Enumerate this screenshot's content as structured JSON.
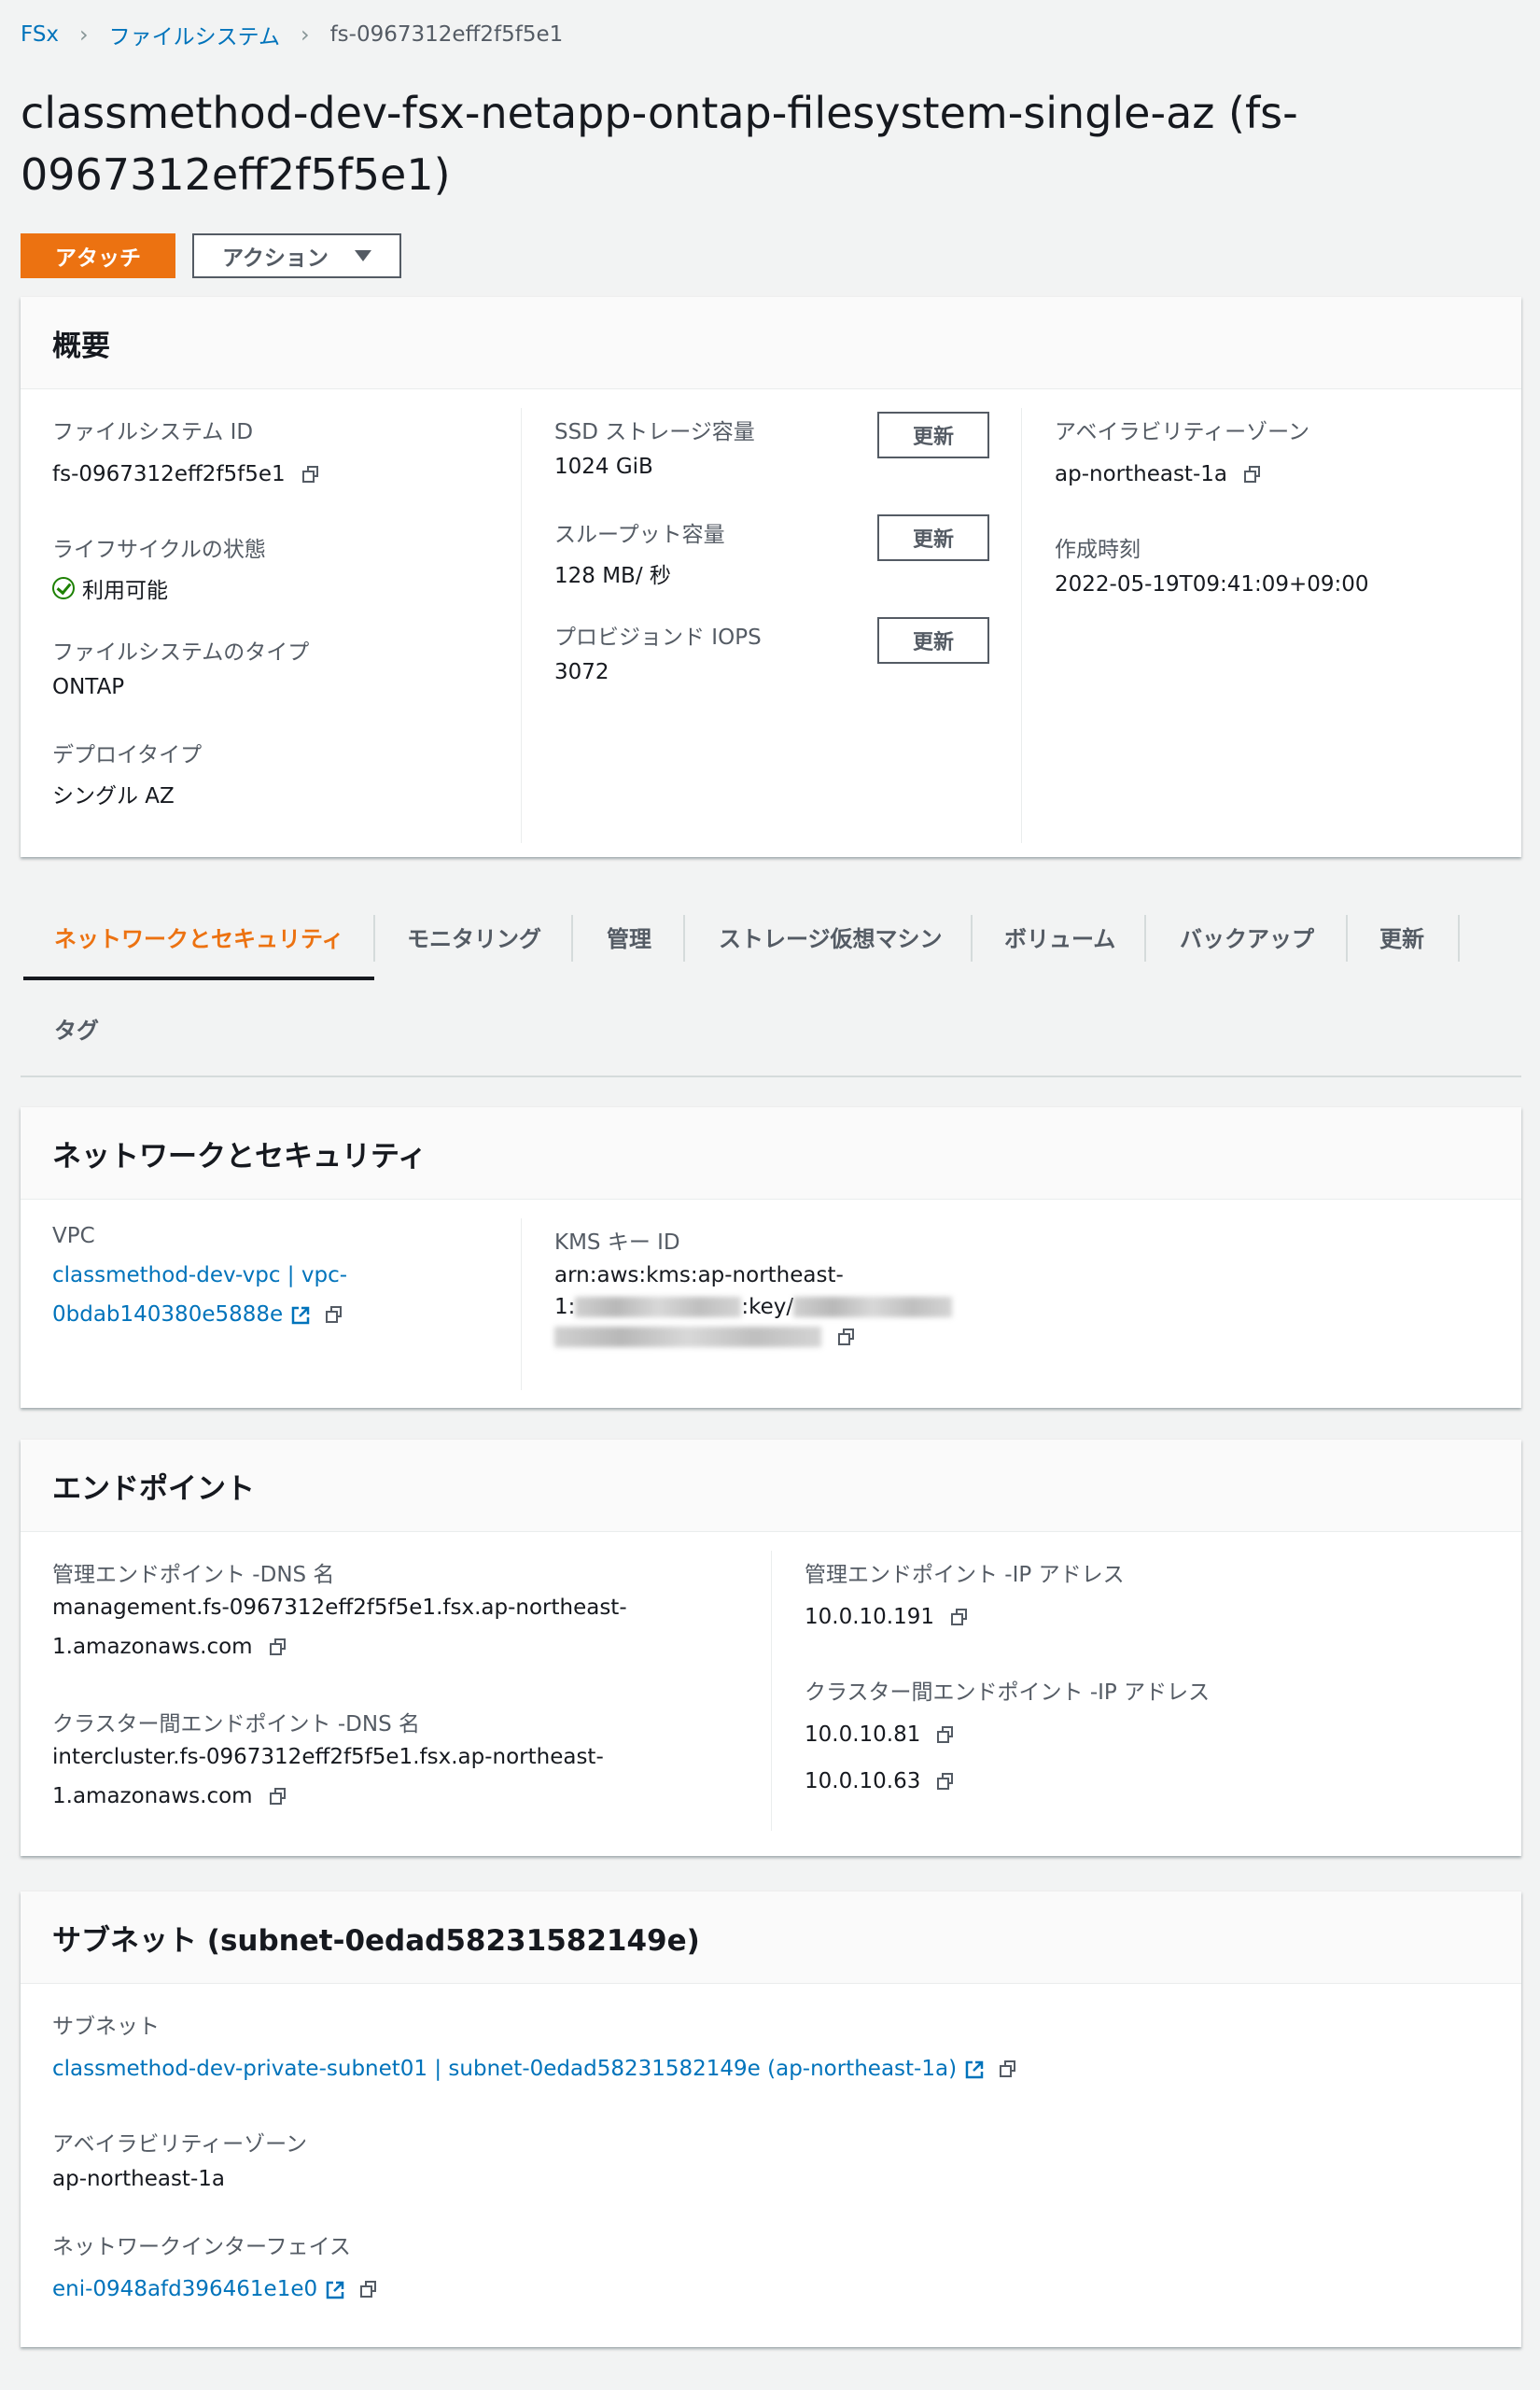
{
  "breadcrumb": {
    "root": "FSx",
    "level2": "ファイルシステム",
    "current": "fs-0967312eff2f5f5e1"
  },
  "title": "classmethod-dev-fsx-netapp-ontap-filesystem-single-az (fs-0967312eff2f5f5e1)",
  "actions": {
    "attach": "アタッチ",
    "actions": "アクション"
  },
  "summary": {
    "header": "概要",
    "fs_id_label": "ファイルシステム ID",
    "fs_id": "fs-0967312eff2f5f5e1",
    "lifecycle_label": "ライフサイクルの状態",
    "lifecycle": "利用可能",
    "fs_type_label": "ファイルシステムのタイプ",
    "fs_type": "ONTAP",
    "deploy_label": "デプロイタイプ",
    "deploy": "シングル AZ",
    "ssd_label": "SSD ストレージ容量",
    "ssd": "1024 GiB",
    "throughput_label": "スループット容量",
    "throughput": "128 MB/ 秒",
    "iops_label": "プロビジョンド IOPS",
    "iops": "3072",
    "update_button": "更新",
    "az_label": "アベイラビリティーゾーン",
    "az": "ap-northeast-1a",
    "created_label": "作成時刻",
    "created": "2022-05-19T09:41:09+09:00"
  },
  "tabs": [
    "ネットワークとセキュリティ",
    "モニタリング",
    "管理",
    "ストレージ仮想マシン",
    "ボリューム",
    "バックアップ",
    "更新",
    "タグ"
  ],
  "network": {
    "header": "ネットワークとセキュリティ",
    "vpc_label": "VPC",
    "vpc_line1": "classmethod-dev-vpc | vpc-",
    "vpc_line2": "0bdab140380e5888e",
    "kms_label": "KMS キー ID",
    "kms_line1": "arn:aws:kms:ap-northeast-",
    "kms_line2_a": "1:",
    "kms_line2_b": ":key/"
  },
  "endpoints": {
    "header": "エンドポイント",
    "mgmt_dns_label": "管理エンドポイント -DNS 名",
    "mgmt_dns_line1": "management.fs-0967312eff2f5f5e1.fsx.ap-northeast-",
    "mgmt_dns_line2": "1.amazonaws.com",
    "ic_dns_label": "クラスター間エンドポイント -DNS 名",
    "ic_dns_line1": "intercluster.fs-0967312eff2f5f5e1.fsx.ap-northeast-",
    "ic_dns_line2": "1.amazonaws.com",
    "mgmt_ip_label": "管理エンドポイント -IP アドレス",
    "mgmt_ip": "10.0.10.191",
    "ic_ip_label": "クラスター間エンドポイント -IP アドレス",
    "ic_ip1": "10.0.10.81",
    "ic_ip2": "10.0.10.63"
  },
  "subnet": {
    "header": "サブネット (subnet-0edad58231582149e)",
    "subnet_label": "サブネット",
    "subnet_value": "classmethod-dev-private-subnet01 | subnet-0edad58231582149e (ap-northeast-1a)",
    "az_label": "アベイラビリティーゾーン",
    "az": "ap-northeast-1a",
    "eni_label": "ネットワークインターフェイス",
    "eni": "eni-0948afd396461e1e0"
  },
  "colors": {
    "accent": "#ec7211",
    "link": "#0073bb",
    "success": "#1d8102"
  }
}
